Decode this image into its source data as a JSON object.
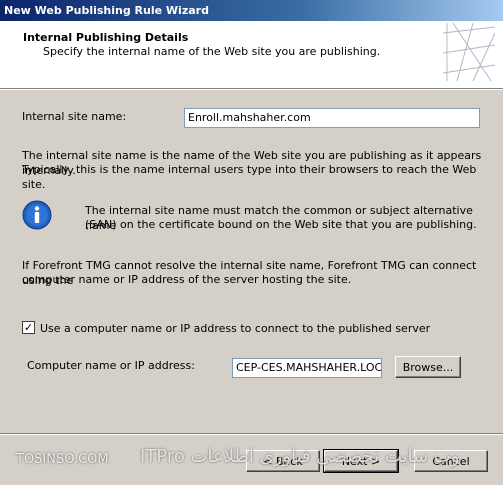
{
  "window": {
    "title": "New Web Publishing Rule Wizard"
  },
  "header": {
    "title": "Internal Publishing Details",
    "subtitle": "Specify the internal name of the Web site you are publishing."
  },
  "internal_site": {
    "label": "Internal site name:",
    "value": "Enroll.mahshaher.com"
  },
  "description": {
    "line1": "The internal site name is the name of the Web site you are publishing as it appears internally.",
    "line2": "Typically, this is the name internal users type into their browsers to reach the Web site."
  },
  "info": {
    "line1": "The internal site name must match the common or subject alternative name",
    "line2": "(SAN) on the certificate bound on the Web site that you are publishing."
  },
  "fallback": {
    "line1": "If Forefront TMG cannot resolve the internal site name, Forefront TMG can connect using the",
    "line2": "computer name or IP address of the server hosting the site."
  },
  "use_ip": {
    "checked": true,
    "check_mark": "✓",
    "label": "Use a computer name or IP address to connect to the published server"
  },
  "computer": {
    "label": "Computer name or IP address:",
    "value": "CEP-CES.MAHSHAHER.LOCAL",
    "browse_label": "Browse..."
  },
  "buttons": {
    "back": "< Back",
    "next": "Next >",
    "cancel": "Cancel"
  },
  "watermark": {
    "left": "TOSINSO.COM",
    "right": "وب سایت تخصصی فناوری اطلاعات ITPro"
  },
  "colors": {
    "titlebar_start": "#0a246a",
    "dialog_bg": "#d4d0c8",
    "info_icon": "#1f5fbf"
  }
}
